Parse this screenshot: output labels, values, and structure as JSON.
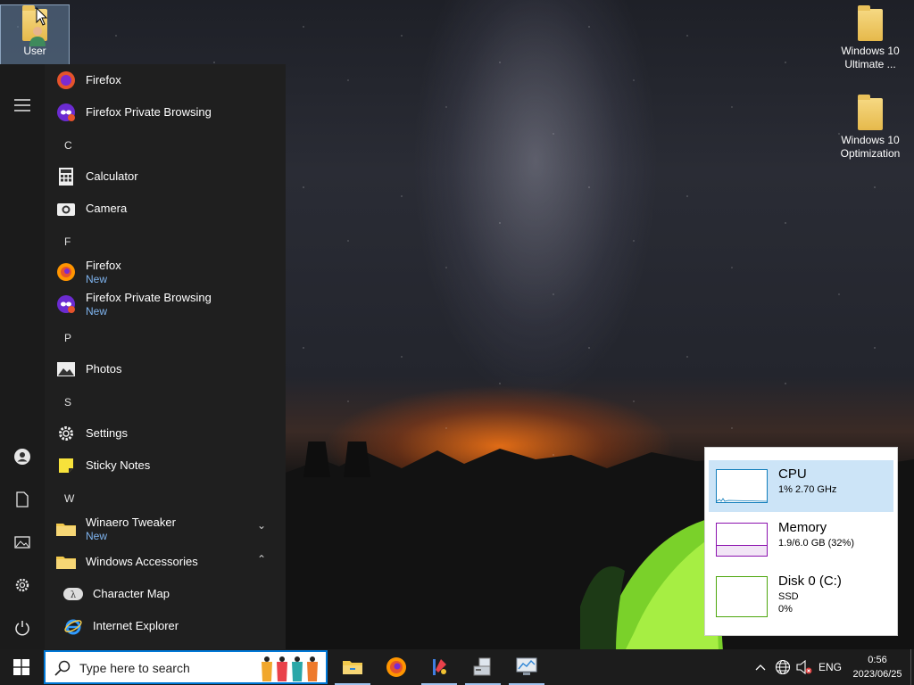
{
  "desktop": {
    "icons": [
      {
        "label": "User",
        "icon": "user-folder-icon"
      },
      {
        "label": "Windows 10 Ultimate ...",
        "icon": "folder-icon"
      },
      {
        "label": "Windows 10 Optimization",
        "icon": "folder-icon"
      }
    ]
  },
  "start_menu": {
    "rail": [
      "hamburger-icon",
      "user-account-icon",
      "documents-icon",
      "pictures-icon",
      "settings-icon",
      "power-icon"
    ],
    "items": [
      {
        "name": "Firefox"
      },
      {
        "name": "Firefox Private Browsing"
      },
      {
        "letter": "C"
      },
      {
        "name": "Calculator"
      },
      {
        "name": "Camera"
      },
      {
        "letter": "F"
      },
      {
        "name": "Firefox",
        "sub": "New"
      },
      {
        "name": "Firefox Private Browsing",
        "sub": "New"
      },
      {
        "letter": "P"
      },
      {
        "name": "Photos"
      },
      {
        "letter": "S"
      },
      {
        "name": "Settings"
      },
      {
        "name": "Sticky Notes"
      },
      {
        "letter": "W"
      },
      {
        "name": "Winaero Tweaker",
        "sub": "New",
        "chevron": "⌄"
      },
      {
        "name": "Windows Accessories",
        "chevron": "⌃"
      },
      {
        "name": "Character Map"
      },
      {
        "name": "Internet Explorer"
      }
    ]
  },
  "resource_monitor": {
    "rows": [
      {
        "title": "CPU",
        "line2": "1%  2.70 GHz",
        "line3": "",
        "color": "#117dbb",
        "selected": true
      },
      {
        "title": "Memory",
        "line2": "1.9/6.0 GB (32%)",
        "line3": "",
        "color": "#8b12ae",
        "fill_fraction": 0.32
      },
      {
        "title": "Disk 0 (C:)",
        "line2": "SSD",
        "line3": "0%",
        "color": "#4da60c"
      }
    ]
  },
  "taskbar": {
    "search_placeholder": "Type here to search",
    "pinned": [
      "file-explorer-icon",
      "firefox-icon",
      "tools-icon",
      "computer-icon",
      "monitor-icon"
    ],
    "tray": {
      "language": "ENG",
      "time": "0:56",
      "date": "2023/06/25"
    }
  }
}
